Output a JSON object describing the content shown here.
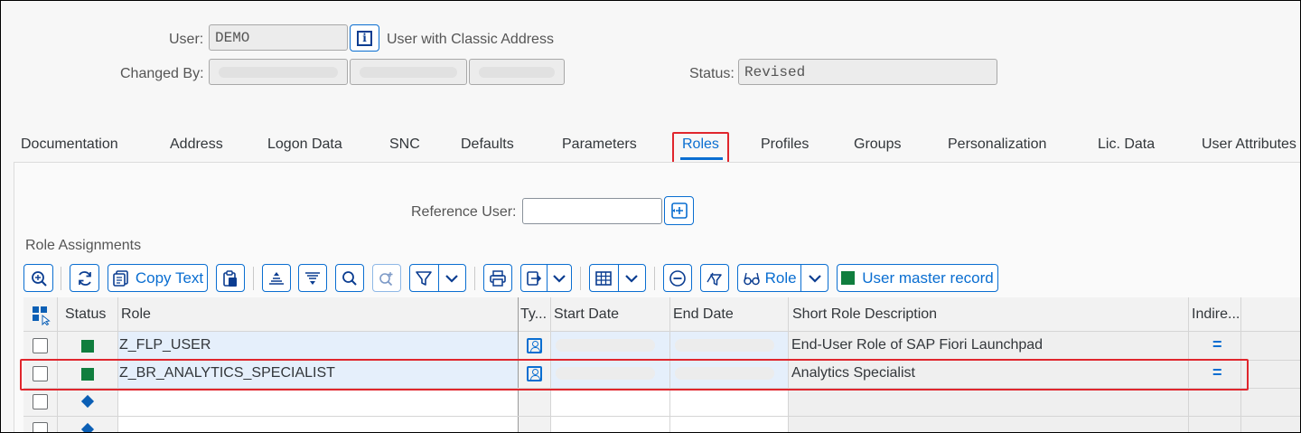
{
  "header": {
    "user_label": "User:",
    "user_value": "DEMO",
    "user_info_icon": "info-icon",
    "address_type": "User with Classic Address",
    "changed_by_label": "Changed By:",
    "status_label": "Status:",
    "status_value": "Revised"
  },
  "tabs": [
    {
      "label": "Documentation"
    },
    {
      "label": "Address"
    },
    {
      "label": "Logon Data"
    },
    {
      "label": "SNC"
    },
    {
      "label": "Defaults"
    },
    {
      "label": "Parameters"
    },
    {
      "label": "Roles",
      "active": true
    },
    {
      "label": "Profiles"
    },
    {
      "label": "Groups"
    },
    {
      "label": "Personalization"
    },
    {
      "label": "Lic. Data"
    },
    {
      "label": "User Attributes"
    }
  ],
  "roles_tab": {
    "reference_user_label": "Reference User:",
    "reference_user_value": "",
    "section_title": "Role Assignments",
    "toolbar": {
      "copy_text_label": "Copy Text",
      "role_label": "Role",
      "user_master_record_label": "User master record"
    },
    "table": {
      "columns": [
        "Status",
        "Role",
        "Ty...",
        "Start Date",
        "End Date",
        "Short Role Description",
        "Indire..."
      ],
      "rows": [
        {
          "status": "green",
          "role": "Z_FLP_USER",
          "description": "End-User Role of SAP Fiori Launchpad",
          "indirect": "="
        },
        {
          "status": "green",
          "role": "Z_BR_ANALYTICS_SPECIALIST",
          "description": "Analytics Specialist",
          "indirect": "="
        },
        {
          "status": "empty",
          "role": "",
          "description": "",
          "indirect": ""
        },
        {
          "status": "empty",
          "role": "",
          "description": "",
          "indirect": ""
        }
      ]
    }
  },
  "colors": {
    "accent": "#0a6ed1",
    "highlight": "#e0262d",
    "status_green": "#107e3e"
  }
}
